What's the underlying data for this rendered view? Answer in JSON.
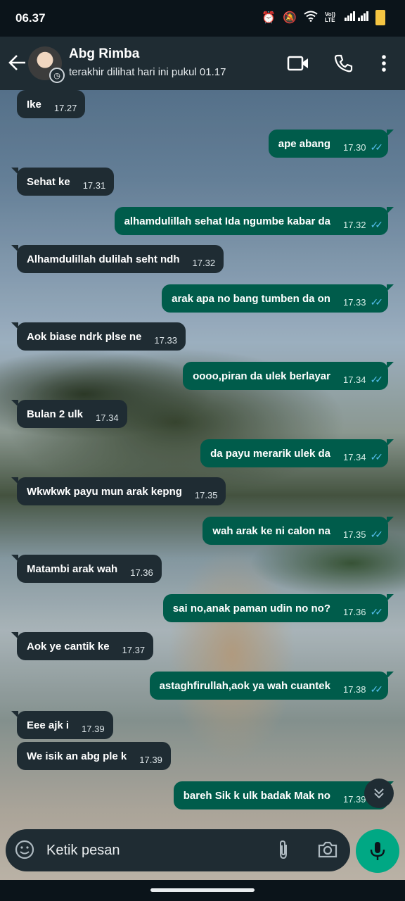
{
  "status_bar": {
    "time": "06.37",
    "network": "Vo)) LTE"
  },
  "header": {
    "contact_name": "Abg Rimba",
    "last_seen": "terakhir dilihat hari ini pukul 01.17"
  },
  "messages": [
    {
      "dir": "in",
      "text": "Ike",
      "time": "17.27"
    },
    {
      "dir": "out",
      "text": "ape abang",
      "time": "17.30"
    },
    {
      "dir": "in",
      "text": "Sehat ke",
      "time": "17.31"
    },
    {
      "dir": "out",
      "text": "alhamdulillah sehat Ida ngumbe kabar da",
      "time": "17.32"
    },
    {
      "dir": "in",
      "text": "Alhamdulillah dulilah seht ndh",
      "time": "17.32"
    },
    {
      "dir": "out",
      "text": "arak apa no bang tumben da on",
      "time": "17.33"
    },
    {
      "dir": "in",
      "text": "Aok biase ndrk plse ne",
      "time": "17.33"
    },
    {
      "dir": "out",
      "text": "oooo,piran da ulek berlayar",
      "time": "17.34"
    },
    {
      "dir": "in",
      "text": "Bulan 2 ulk",
      "time": "17.34"
    },
    {
      "dir": "out",
      "text": "da payu merarik ulek da",
      "time": "17.34"
    },
    {
      "dir": "in",
      "text": "Wkwkwk payu mun arak kepng",
      "time": "17.35"
    },
    {
      "dir": "out",
      "text": "wah arak ke ni calon na",
      "time": "17.35"
    },
    {
      "dir": "in",
      "text": "Matambi arak wah",
      "time": "17.36"
    },
    {
      "dir": "out",
      "text": "sai no,anak paman udin no no?",
      "time": "17.36"
    },
    {
      "dir": "in",
      "text": "Aok ye cantik ke",
      "time": "17.37"
    },
    {
      "dir": "out",
      "text": "astaghfirullah,aok ya wah cuantek",
      "time": "17.38"
    },
    {
      "dir": "in",
      "text": "Eee ajk  i",
      "time": "17.39"
    },
    {
      "dir": "in",
      "text": "We isik an abg ple k",
      "time": "17.39"
    },
    {
      "dir": "out",
      "text": "bareh Sik k ulk badak Mak no",
      "time": "17.39"
    }
  ],
  "composer": {
    "placeholder": "Ketik pesan"
  },
  "icons": {
    "back": "arrow-left-icon",
    "video": "video-call-icon",
    "call": "phone-icon",
    "menu": "more-vert-icon",
    "emoji": "emoji-icon",
    "attach": "paperclip-icon",
    "camera": "camera-icon",
    "mic": "mic-icon",
    "scroll": "double-chevron-down-icon"
  },
  "colors": {
    "header_bg": "#1f2c33",
    "incoming_bubble": "#1f2c33",
    "outgoing_bubble": "#005c4b",
    "read_ticks": "#53bdeb",
    "mic_button": "#00a884"
  }
}
